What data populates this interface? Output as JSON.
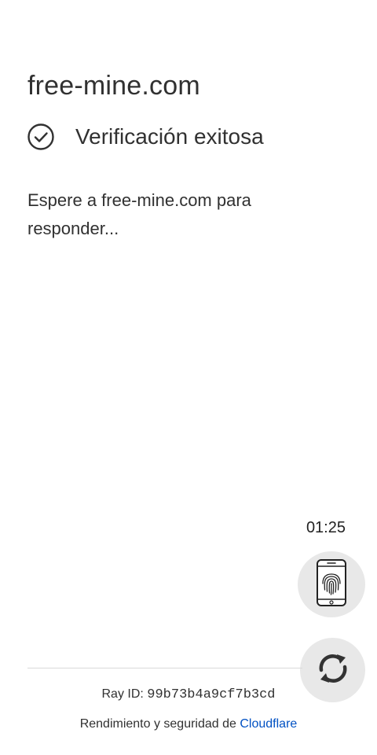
{
  "header": {
    "site_title": "free-mine.com"
  },
  "status": {
    "icon": "check-circle-icon",
    "text": "Verificación exitosa"
  },
  "message": {
    "text": "Espere a free-mine.com para responder..."
  },
  "timer": {
    "value": "01:25"
  },
  "floating_buttons": {
    "fingerprint_icon": "phone-fingerprint-icon",
    "refresh_icon": "refresh-icon"
  },
  "footer": {
    "ray_label": "Ray ID: ",
    "ray_id": "99b73b4a9cf7b3cd",
    "performance_text": "Rendimiento y seguridad de ",
    "cloudflare_link": "Cloudflare"
  },
  "colors": {
    "text": "#313131",
    "link": "#0051c3",
    "fab_background": "#e8e8e8",
    "divider": "#d9d9d9"
  }
}
